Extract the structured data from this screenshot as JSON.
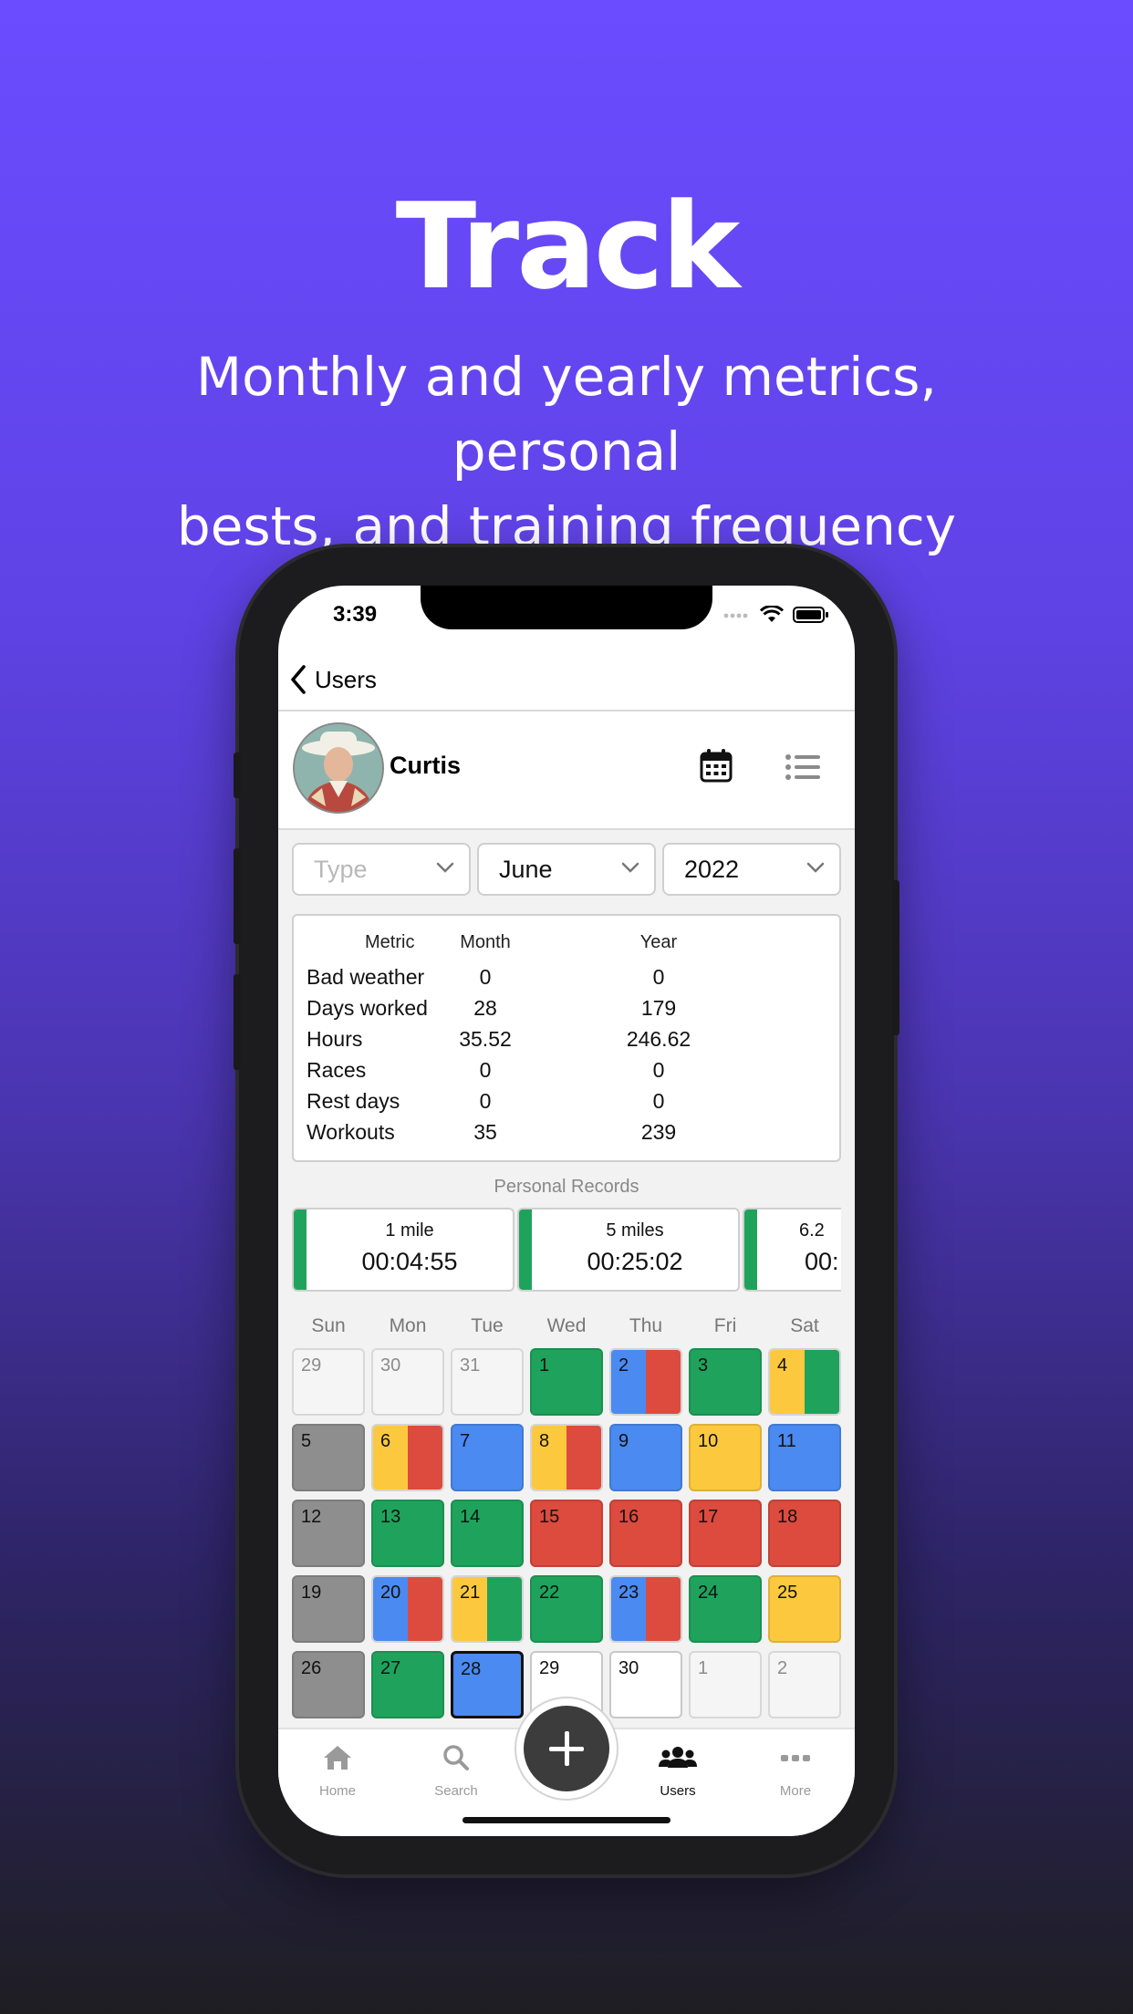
{
  "hero": {
    "title": "Track",
    "subtitle_line1": "Monthly and yearly metrics, personal",
    "subtitle_line2": "bests, and training frequency"
  },
  "status_bar": {
    "time": "3:39"
  },
  "nav": {
    "back_label": "Users"
  },
  "profile": {
    "name": "Curtis"
  },
  "filters": {
    "type_placeholder": "Type",
    "month": "June",
    "year": "2022"
  },
  "metrics": {
    "headers": [
      "Metric",
      "Month",
      "Year"
    ],
    "rows": [
      [
        "Bad weather",
        "0",
        "0"
      ],
      [
        "Days worked",
        "28",
        "179"
      ],
      [
        "Hours",
        "35.52",
        "246.62"
      ],
      [
        "Races",
        "0",
        "0"
      ],
      [
        "Rest days",
        "0",
        "0"
      ],
      [
        "Workouts",
        "35",
        "239"
      ]
    ]
  },
  "personal_records": {
    "title": "Personal Records",
    "cards": [
      {
        "label": "1 mile",
        "value": "00:04:55"
      },
      {
        "label": "5 miles",
        "value": "00:25:02"
      },
      {
        "label": "6.2",
        "value": "00:"
      }
    ]
  },
  "calendar": {
    "weekdays": [
      "Sun",
      "Mon",
      "Tue",
      "Wed",
      "Thu",
      "Fri",
      "Sat"
    ],
    "colors": {
      "green": "#1fa35c",
      "blue": "#4b8af0",
      "red": "#dc4b3e",
      "yellow": "#fcc93e",
      "gray": "#8e8e8e"
    },
    "weeks": [
      [
        {
          "d": "29",
          "s": "other"
        },
        {
          "d": "30",
          "s": "other"
        },
        {
          "d": "31",
          "s": "other"
        },
        {
          "d": "1",
          "c": [
            "green"
          ]
        },
        {
          "d": "2",
          "c": [
            "blue",
            "red"
          ]
        },
        {
          "d": "3",
          "c": [
            "green"
          ]
        },
        {
          "d": "4",
          "c": [
            "yellow",
            "green"
          ]
        }
      ],
      [
        {
          "d": "5",
          "c": [
            "gray"
          ]
        },
        {
          "d": "6",
          "c": [
            "yellow",
            "red"
          ]
        },
        {
          "d": "7",
          "c": [
            "blue"
          ]
        },
        {
          "d": "8",
          "c": [
            "yellow",
            "red"
          ]
        },
        {
          "d": "9",
          "c": [
            "blue"
          ]
        },
        {
          "d": "10",
          "c": [
            "yellow"
          ]
        },
        {
          "d": "11",
          "c": [
            "blue"
          ]
        }
      ],
      [
        {
          "d": "12",
          "c": [
            "gray"
          ]
        },
        {
          "d": "13",
          "c": [
            "green"
          ]
        },
        {
          "d": "14",
          "c": [
            "green"
          ]
        },
        {
          "d": "15",
          "c": [
            "red"
          ]
        },
        {
          "d": "16",
          "c": [
            "red"
          ]
        },
        {
          "d": "17",
          "c": [
            "red"
          ]
        },
        {
          "d": "18",
          "c": [
            "red"
          ]
        }
      ],
      [
        {
          "d": "19",
          "c": [
            "gray"
          ]
        },
        {
          "d": "20",
          "c": [
            "blue",
            "red"
          ]
        },
        {
          "d": "21",
          "c": [
            "yellow",
            "green"
          ]
        },
        {
          "d": "22",
          "c": [
            "green"
          ]
        },
        {
          "d": "23",
          "c": [
            "blue",
            "red"
          ]
        },
        {
          "d": "24",
          "c": [
            "green"
          ]
        },
        {
          "d": "25",
          "c": [
            "yellow"
          ]
        }
      ],
      [
        {
          "d": "26",
          "c": [
            "gray"
          ]
        },
        {
          "d": "27",
          "c": [
            "green"
          ]
        },
        {
          "d": "28",
          "c": [
            "blue"
          ],
          "s": "selected"
        },
        {
          "d": "29",
          "s": "empty"
        },
        {
          "d": "30",
          "s": "empty"
        },
        {
          "d": "1",
          "s": "other"
        },
        {
          "d": "2",
          "s": "other"
        }
      ]
    ]
  },
  "tabbar": {
    "home": "Home",
    "search": "Search",
    "users": "Users",
    "more": "More",
    "active": "users"
  }
}
